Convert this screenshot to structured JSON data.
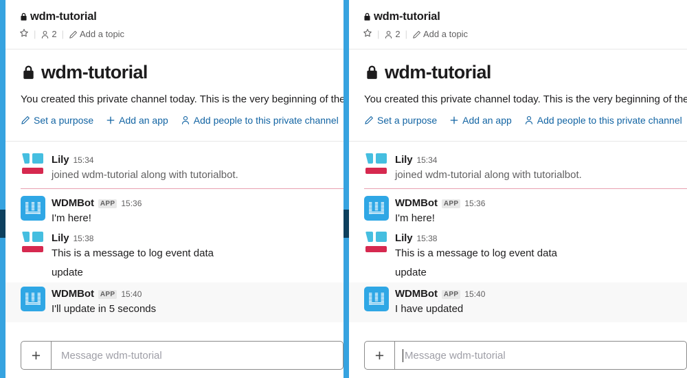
{
  "colors": {
    "rail": "#36a3e0",
    "rail_active": "#0d405e",
    "link": "#1264a3",
    "bot_avatar": "#2fa7e5",
    "lily_cyan": "#45bee0",
    "lily_crimson": "#d6294f",
    "unread_divider": "#e8a0b0",
    "highlight_row": "#f8f8f8",
    "text": "#1d1c1d",
    "muted": "#616061"
  },
  "panes": [
    {
      "header": {
        "channel_name": "wdm-tutorial",
        "lock_icon": "lock-icon",
        "star_icon": "star-icon",
        "member_icon": "member-icon",
        "member_count": "2",
        "separator": "|",
        "topic_icon": "pencil-icon",
        "topic_label": "Add a topic"
      },
      "intro": {
        "lock_icon": "lock-icon",
        "channel_name": "wdm-tutorial",
        "description": "You created this private channel today. This is the very beginning of the",
        "links": [
          {
            "icon": "pencil-icon",
            "label": "Set a purpose"
          },
          {
            "icon": "plus-icon",
            "label": "Add an app"
          },
          {
            "icon": "person-icon",
            "label": "Add people to this private channel"
          }
        ]
      },
      "messages": [
        {
          "avatar": "lily-avatar",
          "author": "Lily",
          "badge": null,
          "time": "15:34",
          "text": "joined wdm-tutorial along with tutorialbot.",
          "muted": true,
          "highlight": false,
          "unread_after": true
        },
        {
          "avatar": "wdmbot-avatar",
          "author": "WDMBot",
          "badge": "APP",
          "time": "15:36",
          "text": "I'm here!",
          "muted": false,
          "highlight": false,
          "unread_after": false
        },
        {
          "avatar": "lily-avatar",
          "author": "Lily",
          "badge": null,
          "time": "15:38",
          "text": "This is a message to log event data",
          "continuation": "update",
          "muted": false,
          "highlight": false,
          "unread_after": false
        },
        {
          "avatar": "wdmbot-avatar",
          "author": "WDMBot",
          "badge": "APP",
          "time": "15:40",
          "text": "I'll update in 5 seconds",
          "muted": false,
          "highlight": true,
          "unread_after": false
        }
      ],
      "composer": {
        "plus_label": "+",
        "placeholder": "Message wdm-tutorial",
        "value": "",
        "caret_visible": false
      }
    },
    {
      "header": {
        "channel_name": "wdm-tutorial",
        "lock_icon": "lock-icon",
        "star_icon": "star-icon",
        "member_icon": "member-icon",
        "member_count": "2",
        "separator": "|",
        "topic_icon": "pencil-icon",
        "topic_label": "Add a topic"
      },
      "intro": {
        "lock_icon": "lock-icon",
        "channel_name": "wdm-tutorial",
        "description": "You created this private channel today. This is the very beginning of the",
        "links": [
          {
            "icon": "pencil-icon",
            "label": "Set a purpose"
          },
          {
            "icon": "plus-icon",
            "label": "Add an app"
          },
          {
            "icon": "person-icon",
            "label": "Add people to this private channel"
          }
        ]
      },
      "messages": [
        {
          "avatar": "lily-avatar",
          "author": "Lily",
          "badge": null,
          "time": "15:34",
          "text": "joined wdm-tutorial along with tutorialbot.",
          "muted": true,
          "highlight": false,
          "unread_after": true
        },
        {
          "avatar": "wdmbot-avatar",
          "author": "WDMBot",
          "badge": "APP",
          "time": "15:36",
          "text": "I'm here!",
          "muted": false,
          "highlight": false,
          "unread_after": false
        },
        {
          "avatar": "lily-avatar",
          "author": "Lily",
          "badge": null,
          "time": "15:38",
          "text": "This is a message to log event data",
          "continuation": "update",
          "muted": false,
          "highlight": false,
          "unread_after": false
        },
        {
          "avatar": "wdmbot-avatar",
          "author": "WDMBot",
          "badge": "APP",
          "time": "15:40",
          "text": "I have updated",
          "muted": false,
          "highlight": true,
          "unread_after": false
        }
      ],
      "composer": {
        "plus_label": "+",
        "placeholder": "Message wdm-tutorial",
        "value": "",
        "caret_visible": true
      }
    }
  ]
}
